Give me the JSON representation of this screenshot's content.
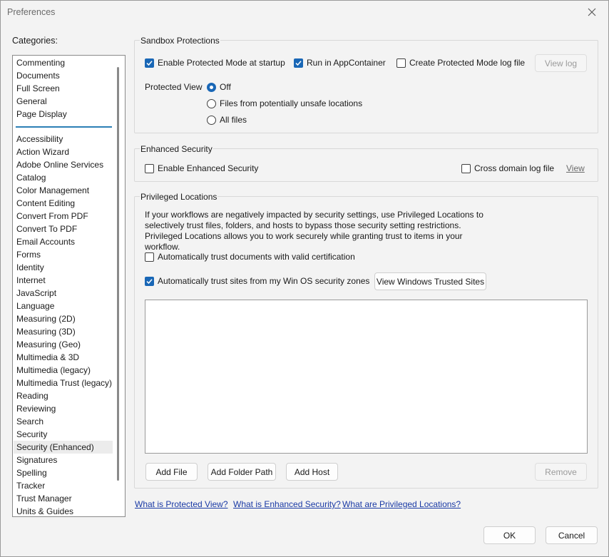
{
  "window": {
    "title": "Preferences"
  },
  "categories": {
    "label": "Categories:",
    "top_items": [
      "Commenting",
      "Documents",
      "Full Screen",
      "General",
      "Page Display"
    ],
    "items": [
      "Accessibility",
      "Action Wizard",
      "Adobe Online Services",
      "Catalog",
      "Color Management",
      "Content Editing",
      "Convert From PDF",
      "Convert To PDF",
      "Email Accounts",
      "Forms",
      "Identity",
      "Internet",
      "JavaScript",
      "Language",
      "Measuring (2D)",
      "Measuring (3D)",
      "Measuring (Geo)",
      "Multimedia & 3D",
      "Multimedia (legacy)",
      "Multimedia Trust (legacy)",
      "Reading",
      "Reviewing",
      "Search",
      "Security",
      "Security (Enhanced)",
      "Signatures",
      "Spelling",
      "Tracker",
      "Trust Manager",
      "Units & Guides"
    ],
    "selected": "Security (Enhanced)"
  },
  "sandbox": {
    "title": "Sandbox Protections",
    "protected_mode_label": "Enable Protected Mode at startup",
    "protected_mode_checked": true,
    "appcontainer_label": "Run in AppContainer",
    "appcontainer_checked": true,
    "log_file_label": "Create Protected Mode log file",
    "log_file_checked": false,
    "view_log_label": "View log",
    "protected_view_label": "Protected View",
    "pv_off": "Off",
    "pv_unsafe": "Files from potentially unsafe locations",
    "pv_all": "All files",
    "pv_selected": "Off"
  },
  "enhanced": {
    "title": "Enhanced Security",
    "enable_label": "Enable Enhanced Security",
    "enable_checked": false,
    "cross_domain_label": "Cross domain log file",
    "cross_domain_checked": false,
    "view_label": "View"
  },
  "privileged": {
    "title": "Privileged Locations",
    "description": "If your workflows are negatively impacted by security settings, use Privileged Locations to selectively trust files, folders, and hosts to bypass those security setting restrictions. Privileged Locations allows you to work securely while granting trust to items in your workflow.",
    "trust_cert_label": "Automatically trust documents with valid certification",
    "trust_cert_checked": false,
    "trust_sites_label": "Automatically trust sites from my Win OS security zones",
    "trust_sites_checked": true,
    "view_trusted_label": "View Windows Trusted Sites",
    "add_file_label": "Add File",
    "add_folder_label": "Add Folder Path",
    "add_host_label": "Add Host",
    "remove_label": "Remove"
  },
  "help_links": {
    "protected_view": "What is Protected View?",
    "enhanced_security": "What is Enhanced Security?",
    "privileged_locations": "What are Privileged Locations?"
  },
  "footer": {
    "ok_label": "OK",
    "cancel_label": "Cancel"
  },
  "colors": {
    "accent": "#1967b6",
    "link": "#1a3aa5",
    "separator": "#2c7fb6"
  }
}
